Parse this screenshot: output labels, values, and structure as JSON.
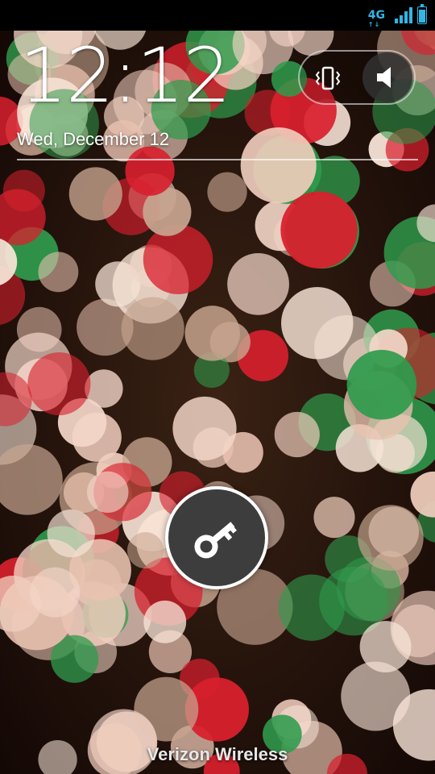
{
  "status_bar": {
    "network_type": "4G",
    "network_arrows": "↑↓",
    "signal_bars": 4,
    "battery_level_percent": 85,
    "accent_color": "#33b5e5"
  },
  "lockscreen": {
    "time": "12:12",
    "date": "Wed, December 12",
    "carrier": "Verizon Wireless",
    "sound_modes": {
      "vibrate_icon": "vibrate-icon",
      "sound_icon": "speaker-icon",
      "selected": "sound"
    },
    "unlock_icon": "key-icon"
  }
}
